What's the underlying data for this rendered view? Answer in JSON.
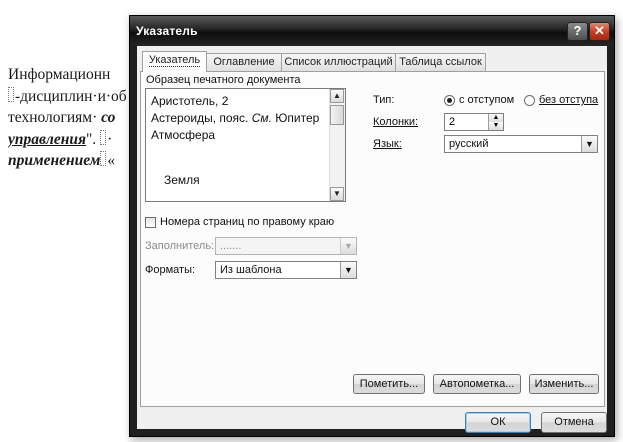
{
  "document": {
    "lines": [
      {
        "parts": [
          "Информационн"
        ]
      },
      {
        "parts": [
          "-дисциплин·и·об"
        ]
      },
      {
        "parts": [
          "технологиям· ",
          "со"
        ]
      },
      {
        "parts": [
          "управления",
          "\". ",
          "·"
        ]
      },
      {
        "parts": [
          "применением",
          "«"
        ]
      }
    ]
  },
  "dialog": {
    "title": "Указатель",
    "help_glyph": "?",
    "close_glyph": "✕",
    "tabs": [
      {
        "label": "Указатель",
        "active": true
      },
      {
        "label": "Оглавление",
        "active": false
      },
      {
        "label": "Список иллюстраций",
        "active": false
      },
      {
        "label": "Таблица ссылок",
        "active": false
      }
    ],
    "preview": {
      "label": "Образец печатного документа",
      "lines": [
        "Аристотель, 2",
        {
          "pre": "Астероиды, пояс. ",
          "italic": "См.",
          "post": " Юпитер"
        },
        "Атмосфера",
        "Земля"
      ]
    },
    "type": {
      "label": "Тип:",
      "options": [
        {
          "label": "с отступом",
          "selected": true
        },
        {
          "label": "без отступа",
          "selected": false
        }
      ]
    },
    "columns": {
      "label": "Колонки:",
      "value": "2"
    },
    "language": {
      "label": "Язык:",
      "value": "русский"
    },
    "right_align": {
      "label": "Номера страниц по правому краю",
      "checked": false
    },
    "leader": {
      "label": "Заполнитель:",
      "value": ".......",
      "enabled": false
    },
    "formats": {
      "label": "Форматы:",
      "value": "Из шаблона"
    },
    "buttons": {
      "mark": "Пометить...",
      "automark": "Автопометка...",
      "modify": "Изменить...",
      "ok": "ОК",
      "cancel": "Отмена"
    },
    "icons": {
      "dropdown": "chevron-down-icon",
      "scroll_up": "chevron-up-icon",
      "scroll_down": "chevron-down-icon",
      "spin_up": "triangle-up-icon",
      "spin_down": "triangle-down-icon"
    },
    "colors": {
      "close_button": "#c23a1e",
      "default_button_border": "#3c7fb1"
    }
  }
}
